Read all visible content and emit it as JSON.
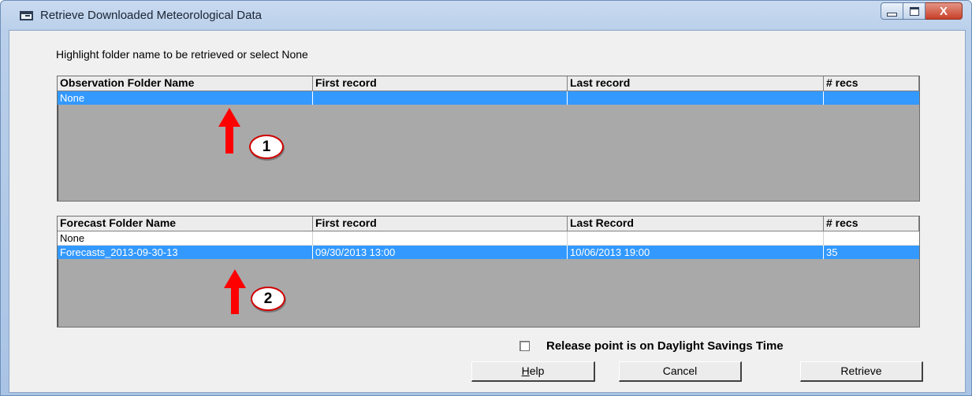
{
  "window": {
    "title": "Retrieve Downloaded Meteorological Data",
    "close_glyph": "X"
  },
  "instruction": "Highlight folder name to be retrieved or select None",
  "observation_grid": {
    "columns": [
      "Observation Folder Name",
      "First record",
      "Last record",
      "# recs"
    ],
    "rows": [
      {
        "name": "None",
        "first": "",
        "last": "",
        "recs": "",
        "selected": true
      }
    ]
  },
  "forecast_grid": {
    "columns": [
      "Forecast Folder Name",
      "First record",
      "Last Record",
      "# recs"
    ],
    "rows": [
      {
        "name": "None",
        "first": "",
        "last": "",
        "recs": "",
        "selected": false
      },
      {
        "name": "Forecasts_2013-09-30-13",
        "first": "09/30/2013 13:00",
        "last": "10/06/2013 19:00",
        "recs": "35",
        "selected": true
      }
    ]
  },
  "annotations": {
    "callout_1": "1",
    "callout_2": "2"
  },
  "dst_checkbox": {
    "label": "Release point is on Daylight Savings Time",
    "checked": false
  },
  "buttons": {
    "help_mnemonic": "H",
    "help_rest": "elp",
    "cancel": "Cancel",
    "retrieve": "Retrieve"
  },
  "colors": {
    "selection": "#3399ff",
    "grid_empty": "#a9a9a9",
    "annotation_red": "#ff0000",
    "dialog_face": "#f0f0f0"
  }
}
